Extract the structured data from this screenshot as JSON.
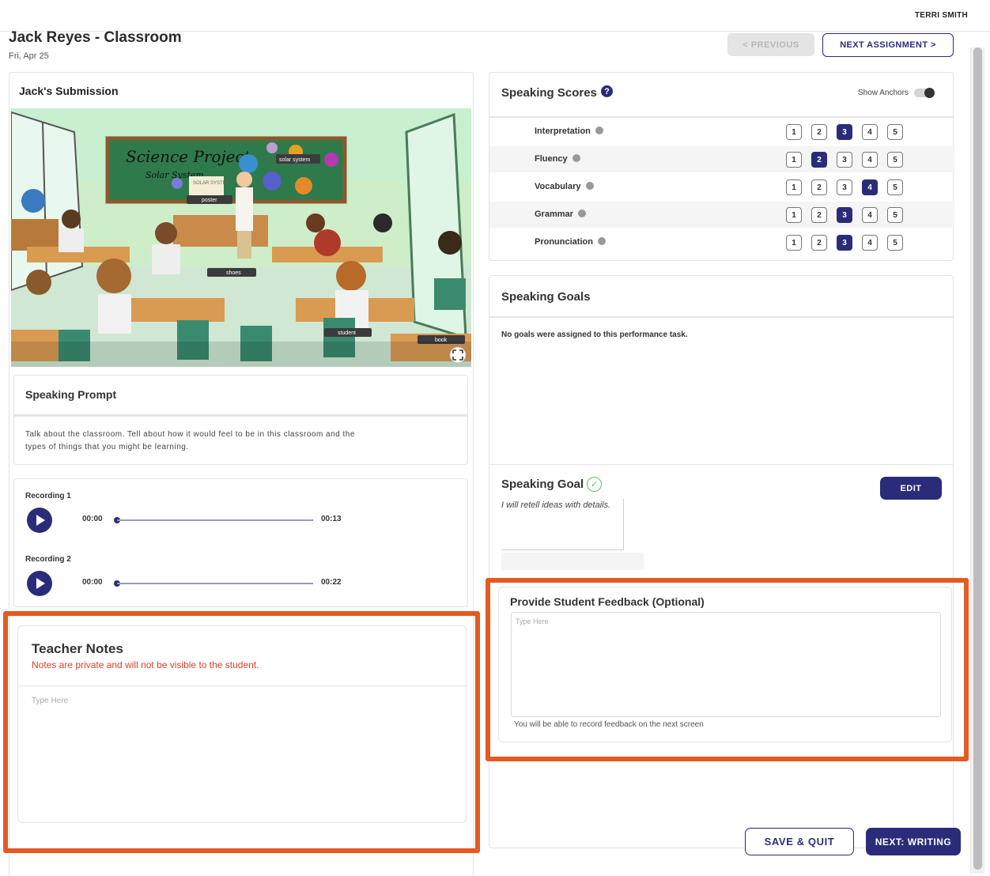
{
  "header": {
    "user_name": "TERRI SMITH",
    "title": "Jack Reyes - Classroom",
    "date": "Fri, Apr 25",
    "prev_label": "< PREVIOUS",
    "next_label": "NEXT ASSIGNMENT >"
  },
  "submission": {
    "title": "Jack's Submission",
    "image_labels": {
      "board_title": "Science Project",
      "board_subtitle": "Solar System",
      "solar_system": "solar system",
      "solar_sign": "SOLAR SYSTEM",
      "poster": "poster",
      "shoes": "shoes",
      "student": "student",
      "book": "book"
    }
  },
  "prompt": {
    "title": "Speaking Prompt",
    "text": "Talk about the classroom. Tell about how it would feel to be in this classroom and the types of things that you might be learning."
  },
  "recordings": [
    {
      "label": "Recording 1",
      "current": "00:00",
      "duration": "00:13",
      "progress": 0
    },
    {
      "label": "Recording 2",
      "current": "00:00",
      "duration": "00:22",
      "progress": 0
    }
  ],
  "notes": {
    "title": "Teacher Notes",
    "subtitle": "Notes are private and will not be visible to the student.",
    "placeholder": "Type Here"
  },
  "scores": {
    "title": "Speaking Scores",
    "help": "?",
    "show_anchors_label": "Show Anchors",
    "show_anchors_on": false,
    "options": [
      "1",
      "2",
      "3",
      "4",
      "5"
    ],
    "rows": [
      {
        "label": "Interpretation",
        "selected": 3
      },
      {
        "label": "Fluency",
        "selected": 2
      },
      {
        "label": "Vocabulary",
        "selected": 4
      },
      {
        "label": "Grammar",
        "selected": 3
      },
      {
        "label": "Pronunciation",
        "selected": 3
      }
    ]
  },
  "goals": {
    "title": "Speaking Goals",
    "empty_text": "No goals were assigned to this performance task.",
    "goal_title": "Speaking Goal",
    "goal_check": "✓",
    "edit_label": "EDIT",
    "goal_text": "I will retell ideas with details."
  },
  "feedback": {
    "title": "Provide Student Feedback (Optional)",
    "placeholder": "Type Here",
    "note": "You will be able to record feedback on the next screen"
  },
  "actions": {
    "save_quit": "SAVE & QUIT",
    "next_writing": "NEXT: WRITING"
  },
  "colors": {
    "primary": "#2a2c7a",
    "highlight": "#e45a23",
    "notes_warning": "#d9412a",
    "goal_check": "#5cbf6a"
  }
}
